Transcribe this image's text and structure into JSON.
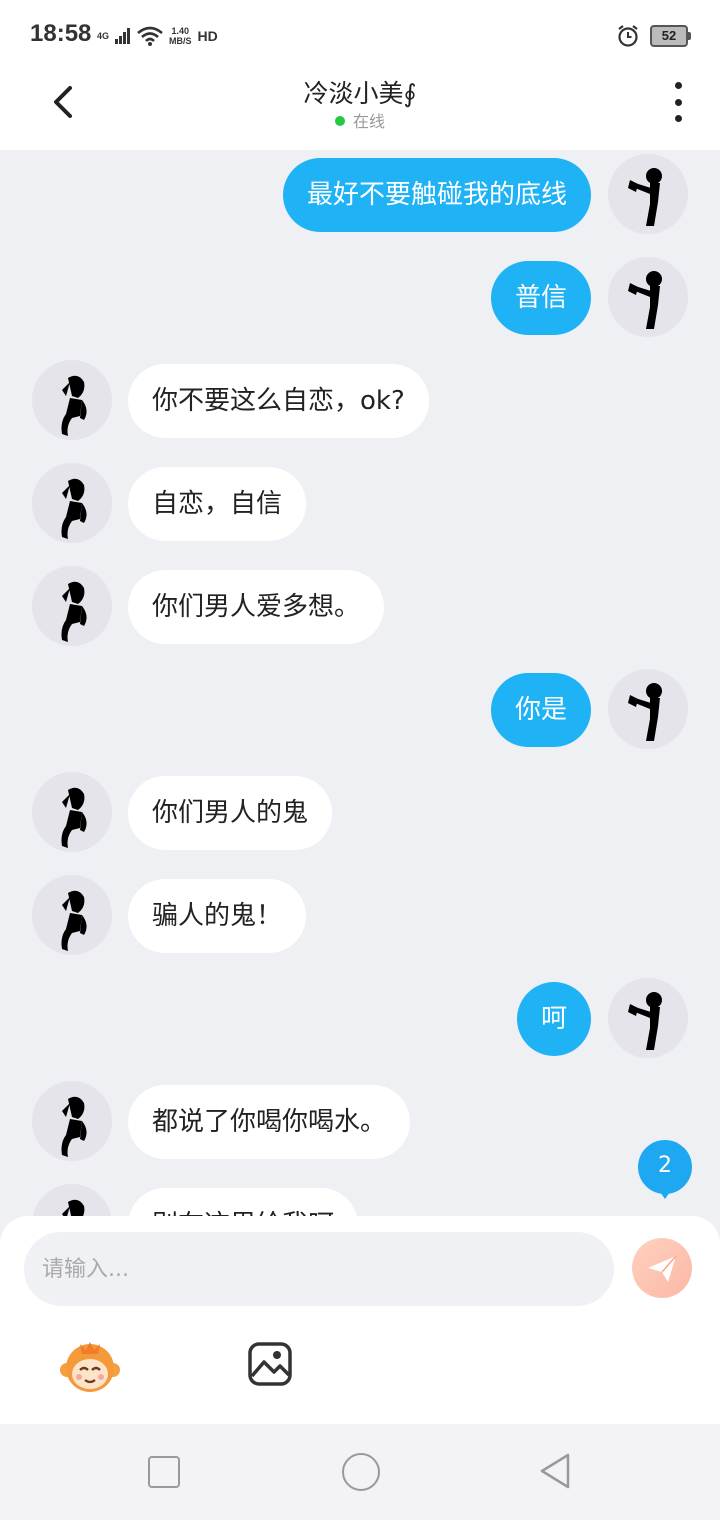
{
  "status_bar": {
    "time": "18:58",
    "network": "4G",
    "speed_value": "1.40",
    "speed_unit": "MB/S",
    "hd": "HD",
    "battery": "52"
  },
  "header": {
    "title": "冷淡小美∮",
    "status": "在线"
  },
  "messages": [
    {
      "side": "out",
      "text": "最好不要触碰我的底线"
    },
    {
      "side": "out",
      "text": "普信"
    },
    {
      "side": "in",
      "text": "你不要这么自恋，ok?"
    },
    {
      "side": "in",
      "text": "自恋，自信"
    },
    {
      "side": "in",
      "text": "你们男人爱多想。"
    },
    {
      "side": "out",
      "text": "你是"
    },
    {
      "side": "in",
      "text": "你们男人的鬼"
    },
    {
      "side": "in",
      "text": "骗人的鬼！"
    },
    {
      "side": "out",
      "text": "呵"
    },
    {
      "side": "in",
      "text": "都说了你喝你喝水。"
    },
    {
      "side": "in",
      "text": "别在这里给我呵"
    }
  ],
  "unread_count": "2",
  "composer": {
    "placeholder": "请输入...",
    "send_icon": "paper-plane-icon",
    "emoji_icon": "monkey-emoji-icon",
    "image_icon": "image-icon"
  },
  "colors": {
    "outgoing_bubble": "#1fb3f6",
    "incoming_bubble": "#ffffff",
    "online_dot": "#25c93f",
    "badge": "#1fa8f2"
  }
}
